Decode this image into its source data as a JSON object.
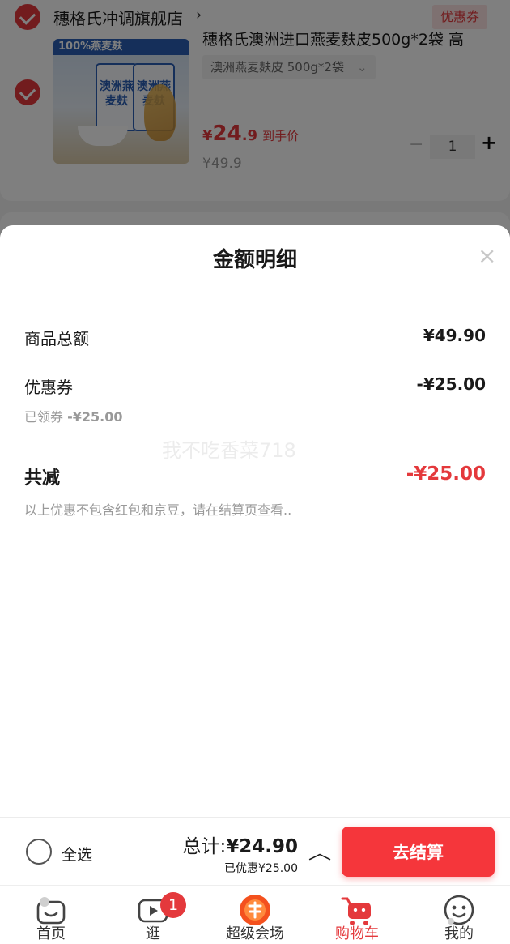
{
  "store": {
    "name": "穗格氏冲调旗舰店",
    "arrow": "›",
    "coupon_tag": "优惠券"
  },
  "product": {
    "title": "穗格氏澳洲进口燕麦麸皮500g*2袋 高",
    "image_text": {
      "banner": "100%燕麦麸",
      "bag_left": "澳洲燕麦麸",
      "bag_right": "澳洲燕麦麸"
    },
    "sku": "澳洲燕麦麸皮 500g*2袋",
    "sku_caret": "⌄",
    "price_yen": "¥",
    "price_int": "24",
    "price_dec": ".9",
    "price_label": "到手价",
    "original_price": "¥49.9",
    "qty_minus": "−",
    "quantity": "1",
    "qty_plus": "+"
  },
  "sheet": {
    "title": "金额明细",
    "close": "×",
    "subtotal_label": "商品总额",
    "subtotal_value": "¥49.90",
    "coupon_label": "优惠券",
    "coupon_value": "-¥25.00",
    "coupon_sub_label": "已领券",
    "coupon_sub_value": "-¥25.00",
    "total_label": "共减",
    "total_value": "-¥25.00",
    "note": "以上优惠不包含红包和京豆，请在结算页查看..",
    "watermark": "我不吃香菜718"
  },
  "checkout": {
    "select_all": "全选",
    "total_prefix": "总计:",
    "total_amount": "¥24.90",
    "saved": "已优惠¥25.00",
    "expand_icon": "︿",
    "button": "去结算"
  },
  "tabs": [
    {
      "label": "首页",
      "icon": "home-icon"
    },
    {
      "label": "逛",
      "icon": "video-icon",
      "badge": "1"
    },
    {
      "label": "超级会场",
      "icon": "super-venue-icon"
    },
    {
      "label": "购物车",
      "icon": "cart-icon",
      "active": true
    },
    {
      "label": "我的",
      "icon": "profile-icon"
    }
  ],
  "colors": {
    "accent": "#e4393c",
    "checkout_button": "#f5363b"
  }
}
